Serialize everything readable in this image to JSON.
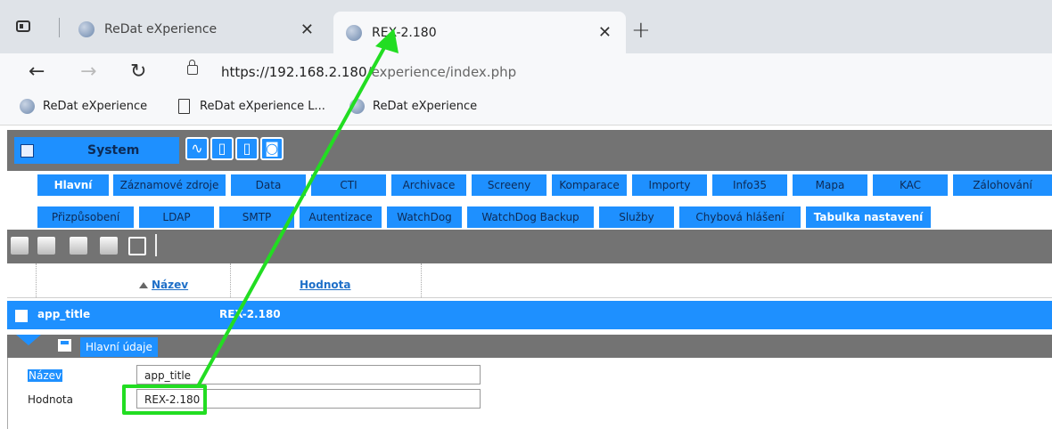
{
  "browser": {
    "tabs": [
      {
        "title": "ReDat eXperience"
      },
      {
        "title": "REX-2.180"
      }
    ],
    "url": {
      "host": "https://192.168.2.180",
      "path": "/experience/index.php"
    },
    "bookmarks": [
      {
        "label": "ReDat eXperience",
        "icon": "globe-icon"
      },
      {
        "label": "ReDat eXperience L...",
        "icon": "page-icon"
      },
      {
        "label": "ReDat eXperience",
        "icon": "globe-icon"
      }
    ]
  },
  "app": {
    "system_label": "System",
    "menu_row1": [
      "Hlavní",
      "Záznamové zdroje",
      "Data",
      "CTI",
      "Archivace",
      "Screeny",
      "Komparace",
      "Importy",
      "Info35",
      "Mapa",
      "KAC",
      "Zálohování"
    ],
    "menu_row2": [
      "Přizpůsobení",
      "LDAP",
      "SMTP",
      "Autentizace",
      "WatchDog",
      "WatchDog Backup",
      "Služby",
      "Chybová hlášení",
      "Tabulka nastavení"
    ],
    "columns": {
      "name": "Název",
      "value": "Hodnota"
    },
    "row": {
      "name": "app_title",
      "value": "REX-2.180"
    },
    "subtab": "Hlavní údaje",
    "form": {
      "name_label": "Název",
      "name_value": "app_title",
      "value_label": "Hodnota",
      "value_value": "REX-2.180"
    }
  },
  "colors": {
    "accent": "#1e90ff",
    "bar": "#737373",
    "highlight": "#22dd22"
  }
}
